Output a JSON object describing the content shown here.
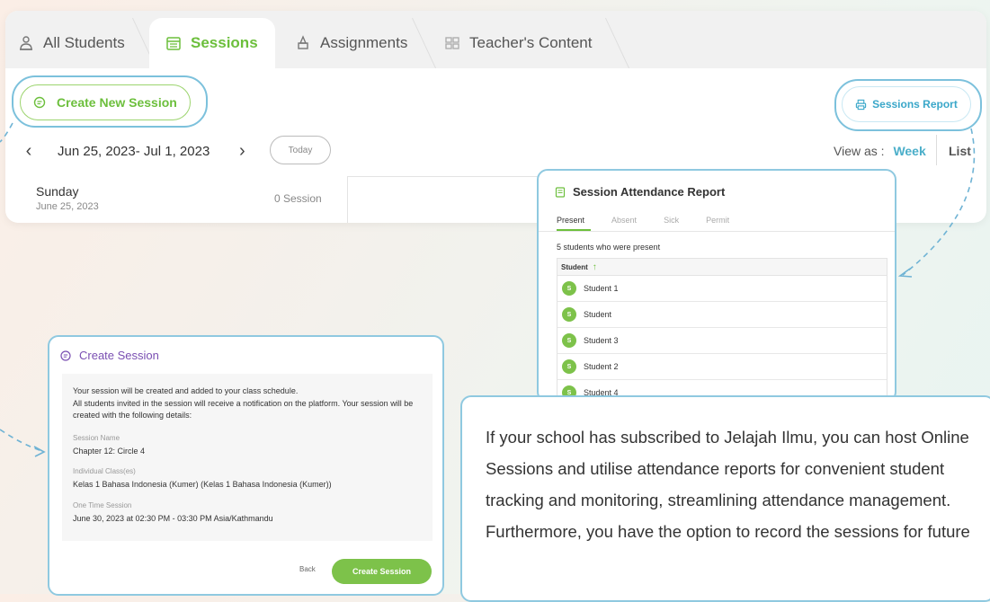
{
  "tabs": [
    {
      "label": "All Students",
      "icon": "students-icon"
    },
    {
      "label": "Sessions",
      "icon": "calendar-icon"
    },
    {
      "label": "Assignments",
      "icon": "assignment-icon"
    },
    {
      "label": "Teacher's Content",
      "icon": "content-icon"
    }
  ],
  "toolbar": {
    "create_label": "Create New Session",
    "report_label": "Sessions Report",
    "date_range": "Jun 25, 2023- Jul 1, 2023",
    "today_label": "Today",
    "prev_icon": "chevron-left-icon",
    "next_icon": "chevron-right-icon",
    "view_as_label": "View as :",
    "view_week": "Week",
    "view_list": "List"
  },
  "schedule": {
    "day_name": "Sunday",
    "day_date": "June 25, 2023",
    "session_count": "0 Session"
  },
  "attendance": {
    "title": "Session Attendance Report",
    "tabs": [
      "Present",
      "Absent",
      "Sick",
      "Permit"
    ],
    "active_tab": "Present",
    "summary": "5 students who were present",
    "column_header": "Student",
    "sort_icon": "sort-up-icon",
    "students": [
      {
        "initial": "S",
        "name": "Student 1"
      },
      {
        "initial": "S",
        "name": "Student"
      },
      {
        "initial": "S",
        "name": "Student 3"
      },
      {
        "initial": "S",
        "name": "Student 2"
      },
      {
        "initial": "S",
        "name": "Student 4"
      }
    ]
  },
  "create_session": {
    "title": "Create Session",
    "intro_line1": "Your session will be created and added to your class schedule.",
    "intro_line2": "All students invited in the session will receive a notification on the platform. Your session will be created with the following details:",
    "session_name_label": "Session Name",
    "session_name": "Chapter 12: Circle 4",
    "class_label": "Individual Class(es)",
    "class_value": "Kelas 1 Bahasa Indonesia (Kumer) (Kelas 1 Bahasa Indonesia (Kumer))",
    "time_label": "One Time Session",
    "time_value": "June 30, 2023 at 02:30 PM - 03:30 PM Asia/Kathmandu",
    "back_label": "Back",
    "submit_label": "Create Session"
  },
  "info": {
    "text": "If your school has subscribed to Jelajah Ilmu, you can host Online Sessions and utilise attendance reports for convenient student tracking and monitoring, streamlining attendance management. Furthermore, you have the option to record the sessions for future"
  },
  "colors": {
    "accent_green": "#6cbf3c",
    "accent_blue": "#4aaec9",
    "highlight_border": "#8fc9e0",
    "purple_title": "#7a4fb2"
  }
}
